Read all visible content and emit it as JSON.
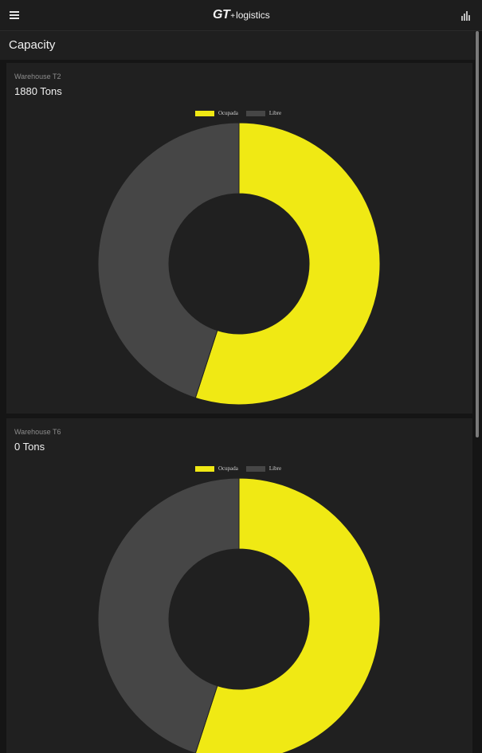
{
  "appbar": {
    "logo_gt": "GT",
    "logo_plus": "+",
    "logo_text": "logistics",
    "menu_icon": "hamburger-menu-icon",
    "stats_icon": "bar-chart-icon"
  },
  "page": {
    "title": "Capacity"
  },
  "colors": {
    "occupied": "#f0e914",
    "free": "#464646",
    "hole": "#202020"
  },
  "warehouses": [
    {
      "name": "Warehouse T2",
      "capacity": "1880 Tons",
      "legend": [
        "Ocupada",
        "Libre"
      ],
      "chart_data": {
        "type": "pie",
        "categories": [
          "Ocupada",
          "Libre"
        ],
        "values": [
          55,
          45
        ]
      }
    },
    {
      "name": "Warehouse T6",
      "capacity": "0 Tons",
      "legend": [
        "Ocupada",
        "Libre"
      ],
      "chart_data": {
        "type": "pie",
        "categories": [
          "Ocupada",
          "Libre"
        ],
        "values": [
          55,
          45
        ]
      }
    }
  ]
}
